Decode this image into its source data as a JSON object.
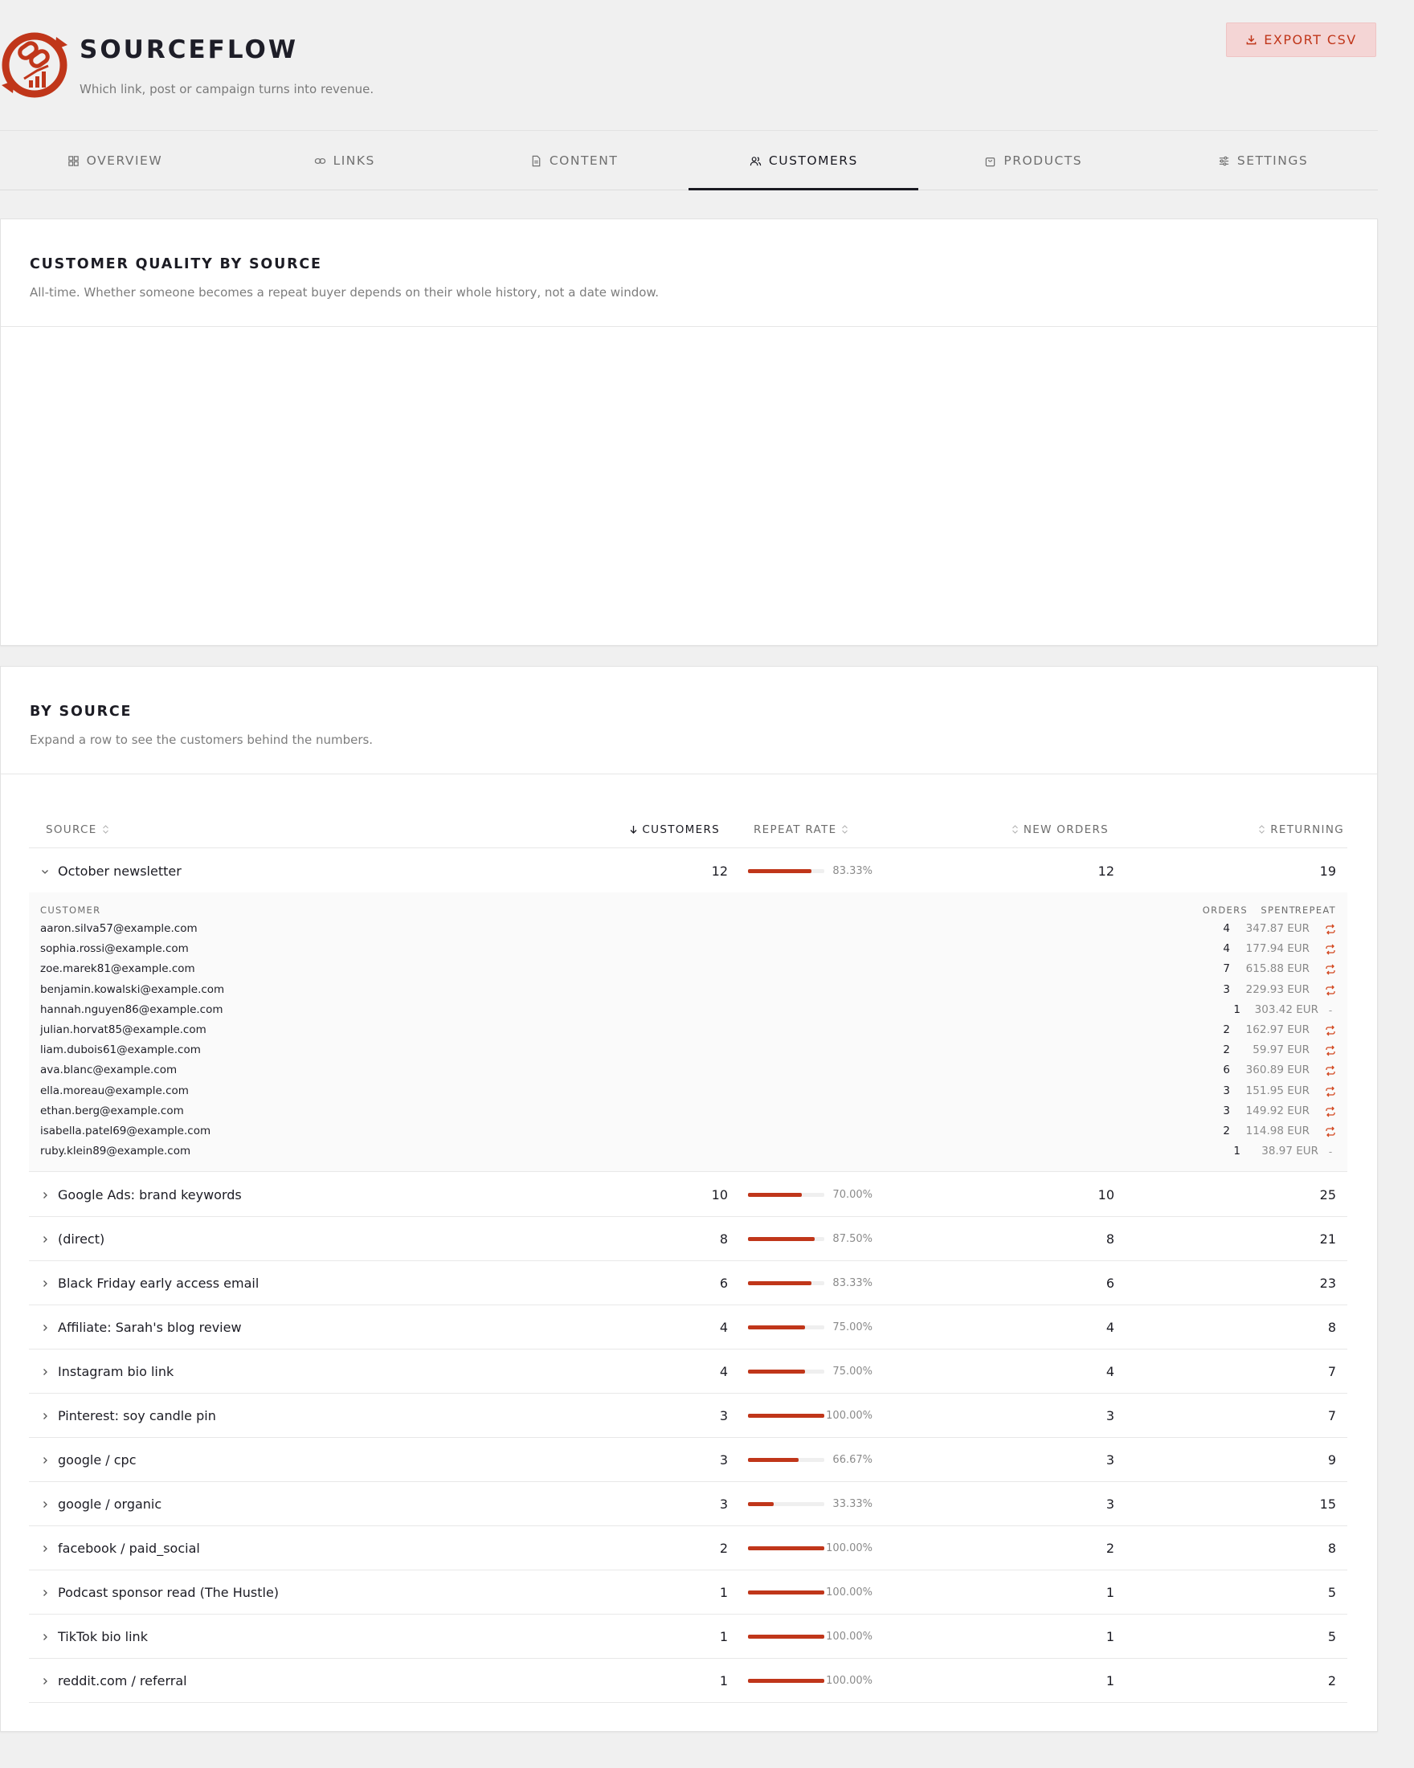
{
  "app": {
    "title": "SOURCEFLOW",
    "tagline": "Which link, post or campaign turns into revenue.",
    "export_label": "EXPORT CSV",
    "accent": "#c0361a"
  },
  "tabs": [
    {
      "label": "OVERVIEW",
      "icon": "grid-icon",
      "active": false
    },
    {
      "label": "LINKS",
      "icon": "link-icon",
      "active": false
    },
    {
      "label": "CONTENT",
      "icon": "document-icon",
      "active": false
    },
    {
      "label": "CUSTOMERS",
      "icon": "users-icon",
      "active": true
    },
    {
      "label": "PRODUCTS",
      "icon": "bag-icon",
      "active": false
    },
    {
      "label": "SETTINGS",
      "icon": "sliders-icon",
      "active": false
    }
  ],
  "quality": {
    "title": "CUSTOMER QUALITY BY SOURCE",
    "subtitle": "All-time. Whether someone becomes a repeat buyer depends on their whole history, not a date window."
  },
  "by_source": {
    "title": "BY SOURCE",
    "subtitle": "Expand a row to see the customers behind the numbers.",
    "columns": {
      "source": "SOURCE",
      "customers": "CUSTOMERS",
      "repeat_rate": "REPEAT RATE",
      "new_orders": "NEW ORDERS",
      "returning": "RETURNING"
    },
    "detail_columns": {
      "customer": "CUSTOMER",
      "orders": "ORDERS",
      "spent": "SPENT",
      "repeat": "REPEAT"
    },
    "rows": [
      {
        "source": "October newsletter",
        "customers": "12",
        "repeat_rate": 83.33,
        "repeat_label": "83.33%",
        "new_orders": "12",
        "returning": "19",
        "expanded": true
      },
      {
        "source": "Google Ads: brand keywords",
        "customers": "10",
        "repeat_rate": 70.0,
        "repeat_label": "70.00%",
        "new_orders": "10",
        "returning": "25"
      },
      {
        "source": "(direct)",
        "customers": "8",
        "repeat_rate": 87.5,
        "repeat_label": "87.50%",
        "new_orders": "8",
        "returning": "21"
      },
      {
        "source": "Black Friday early access email",
        "customers": "6",
        "repeat_rate": 83.33,
        "repeat_label": "83.33%",
        "new_orders": "6",
        "returning": "23"
      },
      {
        "source": "Affiliate: Sarah's blog review",
        "customers": "4",
        "repeat_rate": 75.0,
        "repeat_label": "75.00%",
        "new_orders": "4",
        "returning": "8"
      },
      {
        "source": "Instagram bio link",
        "customers": "4",
        "repeat_rate": 75.0,
        "repeat_label": "75.00%",
        "new_orders": "4",
        "returning": "7"
      },
      {
        "source": "Pinterest: soy candle pin",
        "customers": "3",
        "repeat_rate": 100.0,
        "repeat_label": "100.00%",
        "new_orders": "3",
        "returning": "7"
      },
      {
        "source": "google / cpc",
        "customers": "3",
        "repeat_rate": 66.67,
        "repeat_label": "66.67%",
        "new_orders": "3",
        "returning": "9"
      },
      {
        "source": "google / organic",
        "customers": "3",
        "repeat_rate": 33.33,
        "repeat_label": "33.33%",
        "new_orders": "3",
        "returning": "15"
      },
      {
        "source": "facebook / paid_social",
        "customers": "2",
        "repeat_rate": 100.0,
        "repeat_label": "100.00%",
        "new_orders": "2",
        "returning": "8"
      },
      {
        "source": "Podcast sponsor read (The Hustle)",
        "customers": "1",
        "repeat_rate": 100.0,
        "repeat_label": "100.00%",
        "new_orders": "1",
        "returning": "5"
      },
      {
        "source": "TikTok bio link",
        "customers": "1",
        "repeat_rate": 100.0,
        "repeat_label": "100.00%",
        "new_orders": "1",
        "returning": "5"
      },
      {
        "source": "reddit.com / referral",
        "customers": "1",
        "repeat_rate": 100.0,
        "repeat_label": "100.00%",
        "new_orders": "1",
        "returning": "2"
      }
    ],
    "expanded_customers": [
      {
        "email": "aaron.silva57@example.com",
        "orders": "4",
        "spent": "347.87 EUR",
        "repeat": true
      },
      {
        "email": "sophia.rossi@example.com",
        "orders": "4",
        "spent": "177.94 EUR",
        "repeat": true
      },
      {
        "email": "zoe.marek81@example.com",
        "orders": "7",
        "spent": "615.88 EUR",
        "repeat": true
      },
      {
        "email": "benjamin.kowalski@example.com",
        "orders": "3",
        "spent": "229.93 EUR",
        "repeat": true
      },
      {
        "email": "hannah.nguyen86@example.com",
        "orders": "1",
        "spent": "303.42 EUR",
        "repeat": false
      },
      {
        "email": "julian.horvat85@example.com",
        "orders": "2",
        "spent": "162.97 EUR",
        "repeat": true
      },
      {
        "email": "liam.dubois61@example.com",
        "orders": "2",
        "spent": "59.97 EUR",
        "repeat": true
      },
      {
        "email": "ava.blanc@example.com",
        "orders": "6",
        "spent": "360.89 EUR",
        "repeat": true
      },
      {
        "email": "ella.moreau@example.com",
        "orders": "3",
        "spent": "151.95 EUR",
        "repeat": true
      },
      {
        "email": "ethan.berg@example.com",
        "orders": "3",
        "spent": "149.92 EUR",
        "repeat": true
      },
      {
        "email": "isabella.patel69@example.com",
        "orders": "2",
        "spent": "114.98 EUR",
        "repeat": true
      },
      {
        "email": "ruby.klein89@example.com",
        "orders": "1",
        "spent": "38.97 EUR",
        "repeat": false
      }
    ],
    "no_repeat_mark": "-"
  }
}
